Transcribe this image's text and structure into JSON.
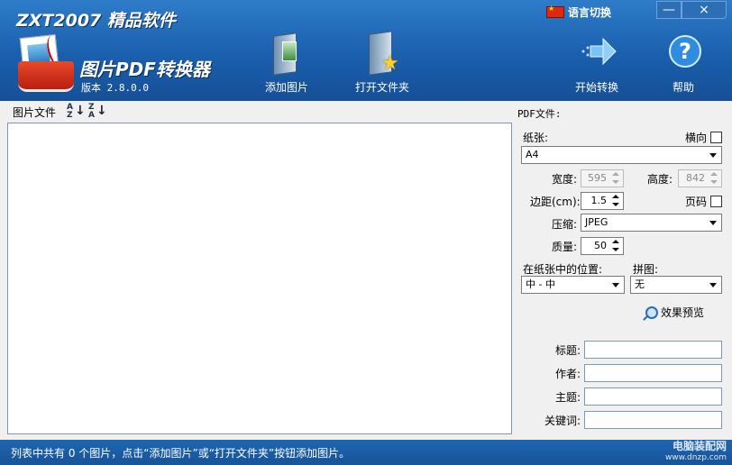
{
  "header": {
    "brand": "ZXT2007 精品软件",
    "app_name": "图片PDF转换器",
    "version": "版本 2.8.0.0",
    "language_label": "语言切换",
    "minimize": "—",
    "close": "×",
    "toolbar": {
      "add_images": "添加图片",
      "open_folder": "打开文件夹",
      "start_convert": "开始转换",
      "help": "帮助"
    }
  },
  "file_list": {
    "header": "图片文件",
    "sort_asc": {
      "a": "A",
      "b": "Z",
      "arrow": "↓"
    },
    "sort_desc": {
      "a": "Z",
      "b": "A",
      "arrow": "↓"
    }
  },
  "pdf_settings": {
    "heading": "PDF文件:",
    "paper_label": "纸张:",
    "landscape_label": "横向",
    "paper_value": "A4",
    "width_label": "宽度:",
    "width_value": "595",
    "height_label": "高度:",
    "height_value": "842",
    "margin_label": "边距(cm):",
    "margin_value": "1.5",
    "page_number_label": "页码",
    "compression_label": "压缩:",
    "compression_value": "JPEG",
    "quality_label": "质量:",
    "quality_value": "50",
    "position_label": "在纸张中的位置:",
    "position_value": "中 - 中",
    "tile_label": "拼图:",
    "tile_value": "无",
    "preview_label": "效果预览",
    "title_label": "标题:",
    "author_label": "作者:",
    "subject_label": "主题:",
    "keywords_label": "关键词:",
    "title_value": "",
    "author_value": "",
    "subject_value": "",
    "keywords_value": ""
  },
  "status": {
    "message": "列表中共有 0 个图片，点击“添加图片”或“打开文件夹”按钮添加图片。",
    "watermark_cn": "电脑装配网",
    "watermark_url": "www.dnzp.com"
  },
  "colors": {
    "title_bar": "#1a5fae",
    "window_bg": "#f0f0f0",
    "status_bar": "#1f66b3"
  }
}
